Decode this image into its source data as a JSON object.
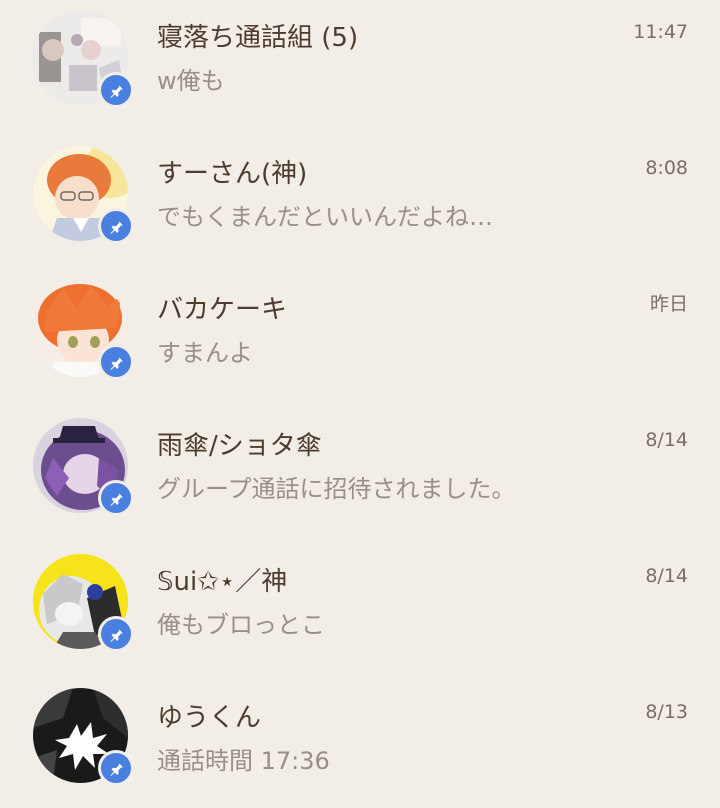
{
  "colors": {
    "background": "#f2eee7",
    "name_text": "#4d3b2e",
    "preview_text": "#9a8f86",
    "time_text": "#7a6d63",
    "pin_badge": "#4a7fe0"
  },
  "chats": [
    {
      "name": "寝落ち通話組 (5)",
      "preview": "w俺も",
      "time": "11:47",
      "avatar": "group-avatar",
      "pinned": true
    },
    {
      "name": "すーさん(神)",
      "preview": "でもくまんだといいんだよね…",
      "time": "8:08",
      "avatar": "user-avatar",
      "pinned": true
    },
    {
      "name": "バカケーキ",
      "preview": "すまんよ",
      "time": "昨日",
      "avatar": "user-avatar",
      "pinned": true
    },
    {
      "name": "雨傘/ショタ傘",
      "preview": "グループ通話に招待されました。",
      "time": "8/14",
      "avatar": "user-avatar",
      "pinned": true
    },
    {
      "name": "𝕊ui✩⋆／神",
      "preview": "俺もブロっとこ",
      "time": "8/14",
      "avatar": "user-avatar",
      "pinned": true
    },
    {
      "name": "ゆうくん",
      "preview": "通話時間 17:36",
      "time": "8/13",
      "avatar": "user-avatar",
      "pinned": true
    }
  ]
}
